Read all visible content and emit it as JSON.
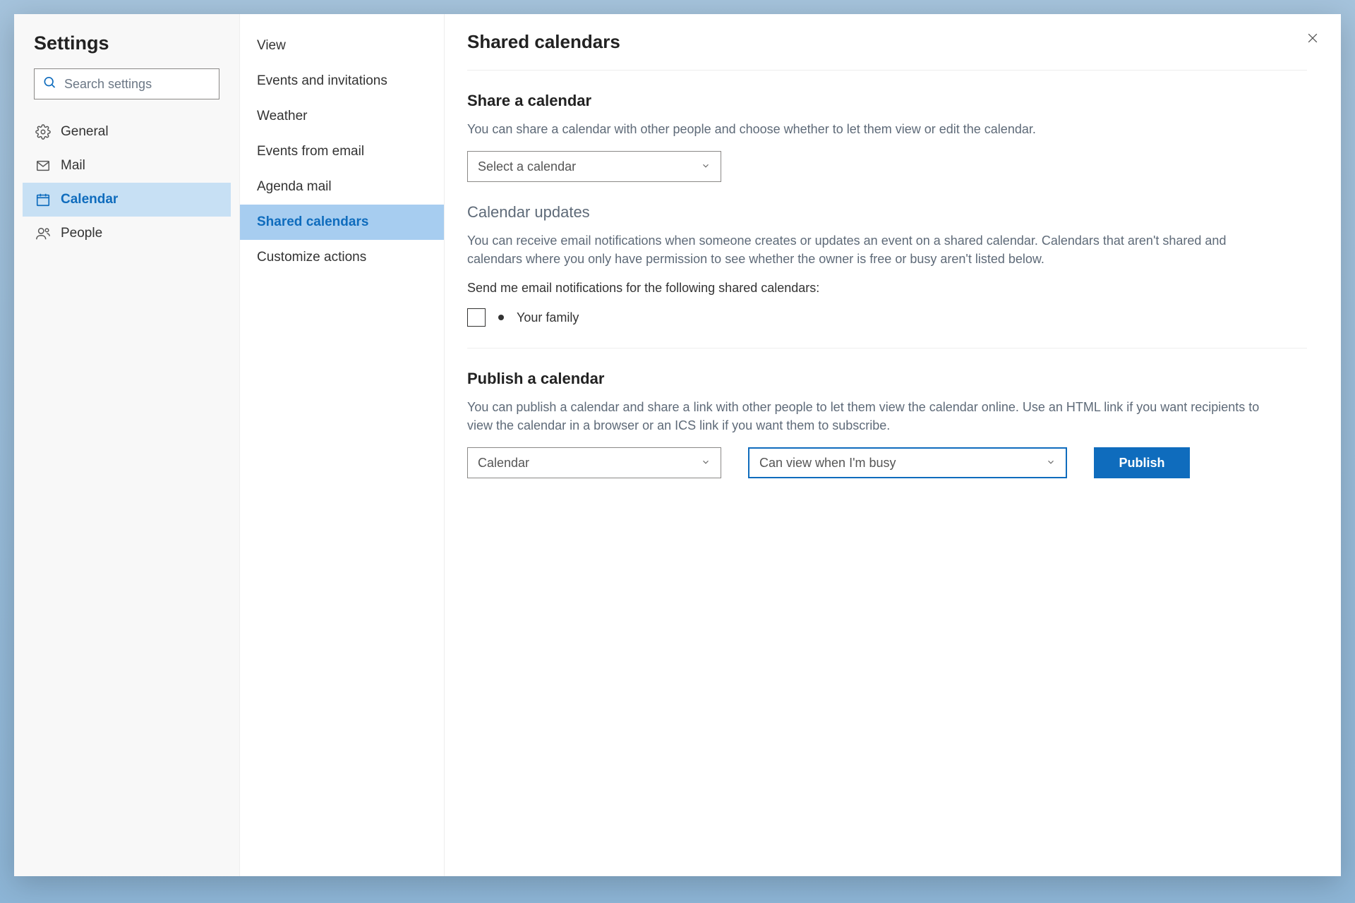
{
  "sidebar": {
    "title": "Settings",
    "search_placeholder": "Search settings",
    "items": [
      {
        "label": "General"
      },
      {
        "label": "Mail"
      },
      {
        "label": "Calendar"
      },
      {
        "label": "People"
      }
    ]
  },
  "subnav": {
    "items": [
      {
        "label": "View"
      },
      {
        "label": "Events and invitations"
      },
      {
        "label": "Weather"
      },
      {
        "label": "Events from email"
      },
      {
        "label": "Agenda mail"
      },
      {
        "label": "Shared calendars"
      },
      {
        "label": "Customize actions"
      }
    ]
  },
  "main": {
    "page_title": "Shared calendars",
    "share": {
      "heading": "Share a calendar",
      "desc": "You can share a calendar with other people and choose whether to let them view or edit the calendar.",
      "dropdown": "Select a calendar"
    },
    "updates": {
      "heading": "Calendar updates",
      "desc": "You can receive email notifications when someone creates or updates an event on a shared calendar. Calendars that aren't shared and calendars where you only have permission to see whether the owner is free or busy aren't listed below.",
      "sub": "Send me email notifications for the following shared calendars:",
      "item_label": "Your family"
    },
    "publish": {
      "heading": "Publish a calendar",
      "desc": "You can publish a calendar and share a link with other people to let them view the calendar online. Use an HTML link if you want recipients to view the calendar in a browser or an ICS link if you want them to subscribe.",
      "calendar_dropdown": "Calendar",
      "permission_dropdown": "Can view when I'm busy",
      "button": "Publish"
    }
  }
}
